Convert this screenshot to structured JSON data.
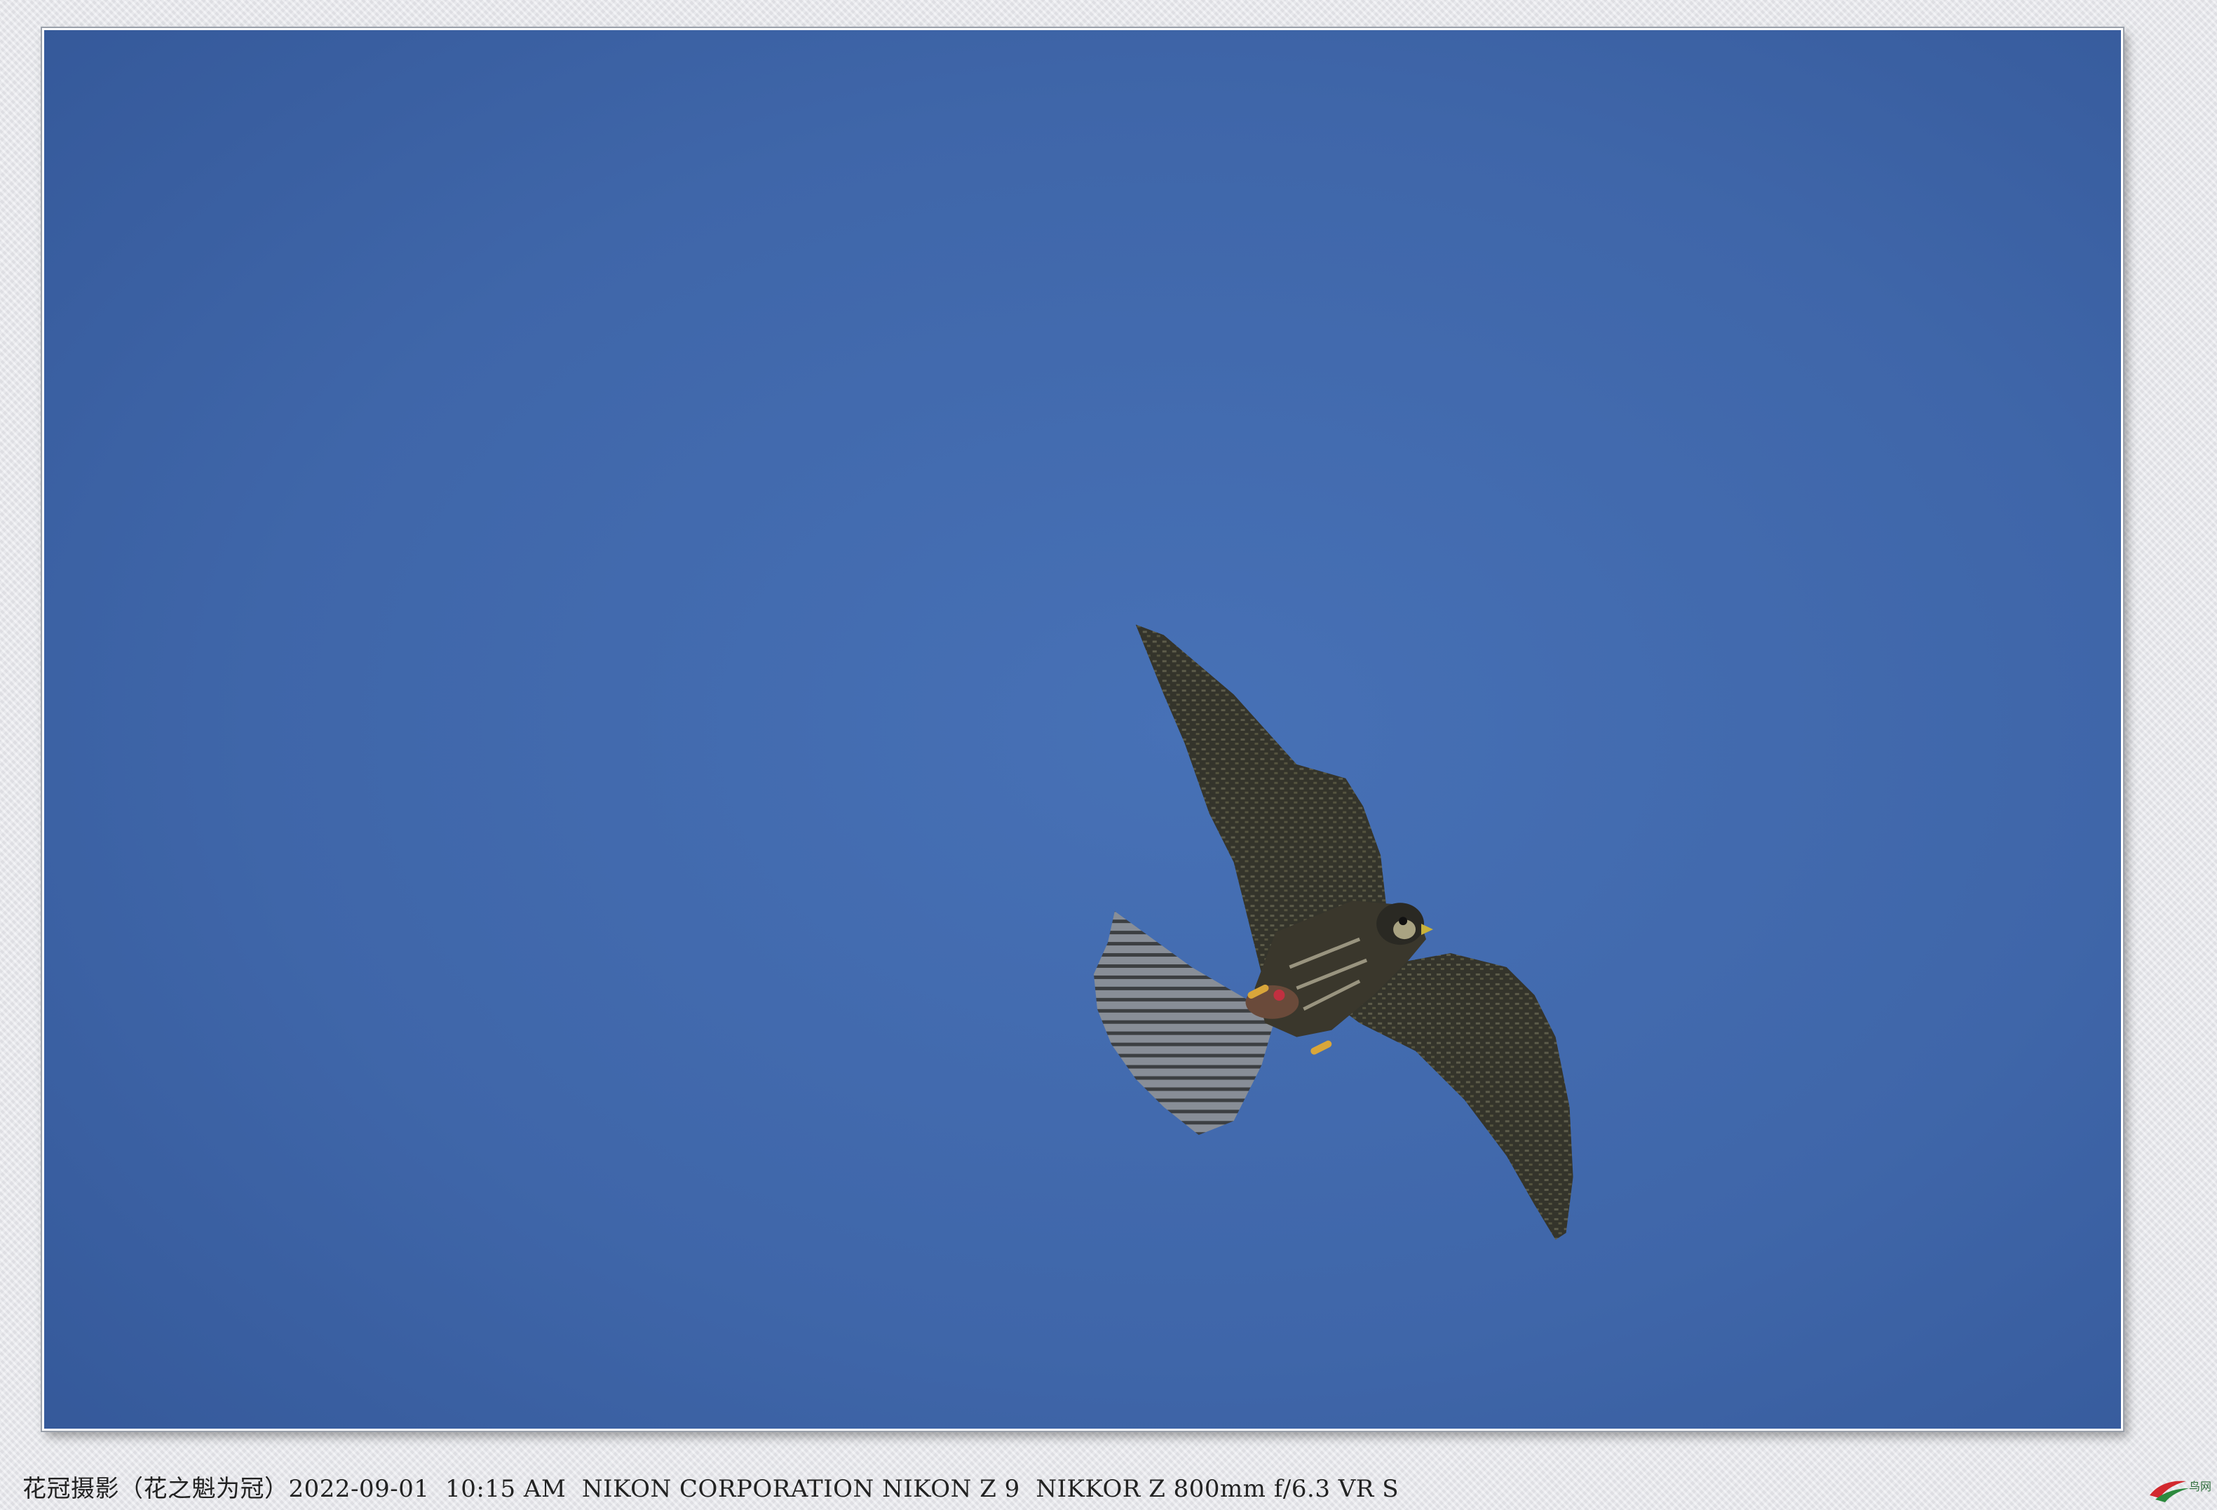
{
  "caption": {
    "text": "花冠摄影（花之魁为冠）2022-09-01  10:15 AM  NIKON CORPORATION NIKON Z 9  NIKKOR Z 800mm f/6.3 VR S"
  },
  "photo": {
    "sky_color": "#3e65a8",
    "sky_color_light": "#4670b4",
    "bird_color": "#2b2a24"
  },
  "logo": {
    "icon": "swoosh-logo-icon",
    "text": "鸟网"
  }
}
